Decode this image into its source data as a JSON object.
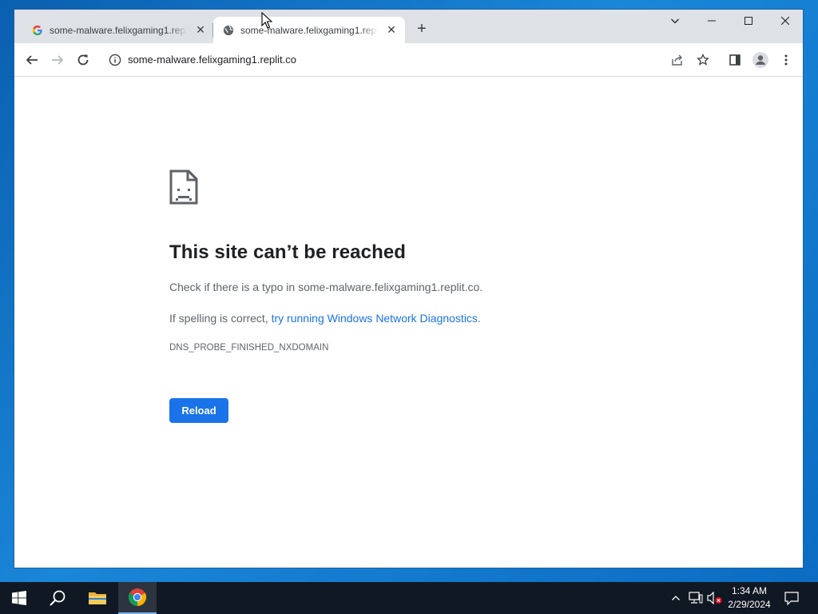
{
  "tabs": [
    {
      "title": "some-malware.felixgaming1.replit.co",
      "favicon": "google-g-icon",
      "active": false
    },
    {
      "title": "some-malware.felixgaming1.replit.co",
      "favicon": "globe-icon",
      "active": true
    }
  ],
  "omnibox": {
    "url": "some-malware.felixgaming1.replit.co"
  },
  "error": {
    "title": "This site can’t be reached",
    "line1_prefix": "Check if there is a typo in ",
    "line1_host": "some-malware.felixgaming1.replit.co",
    "line1_suffix": ".",
    "line2_prefix": "If spelling is correct, ",
    "line2_link": "try running Windows Network Diagnostics",
    "line2_suffix": ".",
    "code": "DNS_PROBE_FINISHED_NXDOMAIN",
    "reload_label": "Reload"
  },
  "taskbar": {
    "time": "1:34 AM",
    "date": "2/29/2024"
  },
  "colors": {
    "accent": "#1a73e8",
    "tabstrip": "#dee1e6",
    "taskbar": "#101823"
  }
}
